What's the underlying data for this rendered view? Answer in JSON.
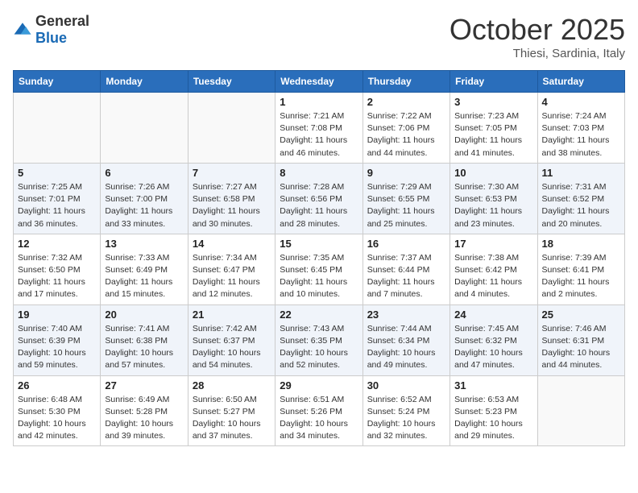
{
  "header": {
    "logo_general": "General",
    "logo_blue": "Blue",
    "month": "October 2025",
    "location": "Thiesi, Sardinia, Italy"
  },
  "weekdays": [
    "Sunday",
    "Monday",
    "Tuesday",
    "Wednesday",
    "Thursday",
    "Friday",
    "Saturday"
  ],
  "weeks": [
    [
      {
        "day": "",
        "info": ""
      },
      {
        "day": "",
        "info": ""
      },
      {
        "day": "",
        "info": ""
      },
      {
        "day": "1",
        "info": "Sunrise: 7:21 AM\nSunset: 7:08 PM\nDaylight: 11 hours\nand 46 minutes."
      },
      {
        "day": "2",
        "info": "Sunrise: 7:22 AM\nSunset: 7:06 PM\nDaylight: 11 hours\nand 44 minutes."
      },
      {
        "day": "3",
        "info": "Sunrise: 7:23 AM\nSunset: 7:05 PM\nDaylight: 11 hours\nand 41 minutes."
      },
      {
        "day": "4",
        "info": "Sunrise: 7:24 AM\nSunset: 7:03 PM\nDaylight: 11 hours\nand 38 minutes."
      }
    ],
    [
      {
        "day": "5",
        "info": "Sunrise: 7:25 AM\nSunset: 7:01 PM\nDaylight: 11 hours\nand 36 minutes."
      },
      {
        "day": "6",
        "info": "Sunrise: 7:26 AM\nSunset: 7:00 PM\nDaylight: 11 hours\nand 33 minutes."
      },
      {
        "day": "7",
        "info": "Sunrise: 7:27 AM\nSunset: 6:58 PM\nDaylight: 11 hours\nand 30 minutes."
      },
      {
        "day": "8",
        "info": "Sunrise: 7:28 AM\nSunset: 6:56 PM\nDaylight: 11 hours\nand 28 minutes."
      },
      {
        "day": "9",
        "info": "Sunrise: 7:29 AM\nSunset: 6:55 PM\nDaylight: 11 hours\nand 25 minutes."
      },
      {
        "day": "10",
        "info": "Sunrise: 7:30 AM\nSunset: 6:53 PM\nDaylight: 11 hours\nand 23 minutes."
      },
      {
        "day": "11",
        "info": "Sunrise: 7:31 AM\nSunset: 6:52 PM\nDaylight: 11 hours\nand 20 minutes."
      }
    ],
    [
      {
        "day": "12",
        "info": "Sunrise: 7:32 AM\nSunset: 6:50 PM\nDaylight: 11 hours\nand 17 minutes."
      },
      {
        "day": "13",
        "info": "Sunrise: 7:33 AM\nSunset: 6:49 PM\nDaylight: 11 hours\nand 15 minutes."
      },
      {
        "day": "14",
        "info": "Sunrise: 7:34 AM\nSunset: 6:47 PM\nDaylight: 11 hours\nand 12 minutes."
      },
      {
        "day": "15",
        "info": "Sunrise: 7:35 AM\nSunset: 6:45 PM\nDaylight: 11 hours\nand 10 minutes."
      },
      {
        "day": "16",
        "info": "Sunrise: 7:37 AM\nSunset: 6:44 PM\nDaylight: 11 hours\nand 7 minutes."
      },
      {
        "day": "17",
        "info": "Sunrise: 7:38 AM\nSunset: 6:42 PM\nDaylight: 11 hours\nand 4 minutes."
      },
      {
        "day": "18",
        "info": "Sunrise: 7:39 AM\nSunset: 6:41 PM\nDaylight: 11 hours\nand 2 minutes."
      }
    ],
    [
      {
        "day": "19",
        "info": "Sunrise: 7:40 AM\nSunset: 6:39 PM\nDaylight: 10 hours\nand 59 minutes."
      },
      {
        "day": "20",
        "info": "Sunrise: 7:41 AM\nSunset: 6:38 PM\nDaylight: 10 hours\nand 57 minutes."
      },
      {
        "day": "21",
        "info": "Sunrise: 7:42 AM\nSunset: 6:37 PM\nDaylight: 10 hours\nand 54 minutes."
      },
      {
        "day": "22",
        "info": "Sunrise: 7:43 AM\nSunset: 6:35 PM\nDaylight: 10 hours\nand 52 minutes."
      },
      {
        "day": "23",
        "info": "Sunrise: 7:44 AM\nSunset: 6:34 PM\nDaylight: 10 hours\nand 49 minutes."
      },
      {
        "day": "24",
        "info": "Sunrise: 7:45 AM\nSunset: 6:32 PM\nDaylight: 10 hours\nand 47 minutes."
      },
      {
        "day": "25",
        "info": "Sunrise: 7:46 AM\nSunset: 6:31 PM\nDaylight: 10 hours\nand 44 minutes."
      }
    ],
    [
      {
        "day": "26",
        "info": "Sunrise: 6:48 AM\nSunset: 5:30 PM\nDaylight: 10 hours\nand 42 minutes."
      },
      {
        "day": "27",
        "info": "Sunrise: 6:49 AM\nSunset: 5:28 PM\nDaylight: 10 hours\nand 39 minutes."
      },
      {
        "day": "28",
        "info": "Sunrise: 6:50 AM\nSunset: 5:27 PM\nDaylight: 10 hours\nand 37 minutes."
      },
      {
        "day": "29",
        "info": "Sunrise: 6:51 AM\nSunset: 5:26 PM\nDaylight: 10 hours\nand 34 minutes."
      },
      {
        "day": "30",
        "info": "Sunrise: 6:52 AM\nSunset: 5:24 PM\nDaylight: 10 hours\nand 32 minutes."
      },
      {
        "day": "31",
        "info": "Sunrise: 6:53 AM\nSunset: 5:23 PM\nDaylight: 10 hours\nand 29 minutes."
      },
      {
        "day": "",
        "info": ""
      }
    ]
  ]
}
